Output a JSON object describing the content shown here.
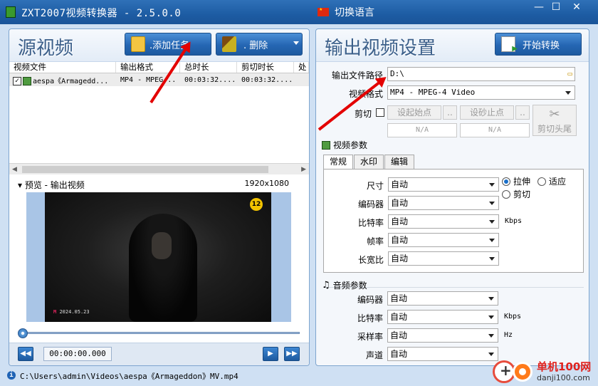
{
  "window": {
    "title": "ZXT2007视频转换器 - 2.5.0.0",
    "language_label": "切换语言",
    "min": "—",
    "max": "☐",
    "close": "✕"
  },
  "left": {
    "title": "源视频",
    "add_task": ".添加任务",
    "delete": ".  删除",
    "columns": [
      "视频文件",
      "输出格式",
      "总时长",
      "剪切时长",
      "处"
    ],
    "rows": [
      {
        "file": "aespa《Armagedd...",
        "format": "MP4 - MPEG...",
        "total": "00:03:32....",
        "cut": "00:03:32...."
      }
    ],
    "preview_label": "▾ 预览 - 输出视频",
    "resolution": "1920x1080",
    "rating_badge": "12",
    "watermark_date": "2024.05.23",
    "time": "00:00:00.000"
  },
  "right": {
    "title": "输出视频设置",
    "start": "开始转换",
    "output_path_label": "输出文件路径",
    "output_path": "D:\\",
    "format_label": "视频格式",
    "format_value": "MP4 - MPEG-4 Video",
    "cut_label": "剪切",
    "set_start": "设起始点",
    "set_end": "设砂止点",
    "more": "..",
    "na1": "N/A",
    "na2": "N/A",
    "cut_head_tail": "剪切头尾",
    "video_params": "视频参数",
    "tabs": [
      "常规",
      "水印",
      "编辑"
    ],
    "video_fields": [
      {
        "label": "尺寸",
        "value": "自动"
      },
      {
        "label": "编码器",
        "value": "自动"
      },
      {
        "label": "比特率",
        "value": "自动"
      },
      {
        "label": "帧率",
        "value": "自动"
      },
      {
        "label": "长宽比",
        "value": "自动"
      }
    ],
    "radio_stretch": "拉伸",
    "radio_fit": "适应",
    "radio_crop": "剪切",
    "kbps": "Kbps",
    "audio_params": "音频参数",
    "audio_fields": [
      {
        "label": "编码器",
        "value": "自动"
      },
      {
        "label": "比特率",
        "value": "自动"
      },
      {
        "label": "采样率",
        "value": "自动"
      },
      {
        "label": "声道",
        "value": "自动"
      }
    ],
    "hz": "Hz"
  },
  "status": {
    "path": "C:\\Users\\admin\\Videos\\aespa《Armageddon》MV.mp4"
  },
  "brand": {
    "name": "单机100网",
    "url": "danji100.com"
  }
}
